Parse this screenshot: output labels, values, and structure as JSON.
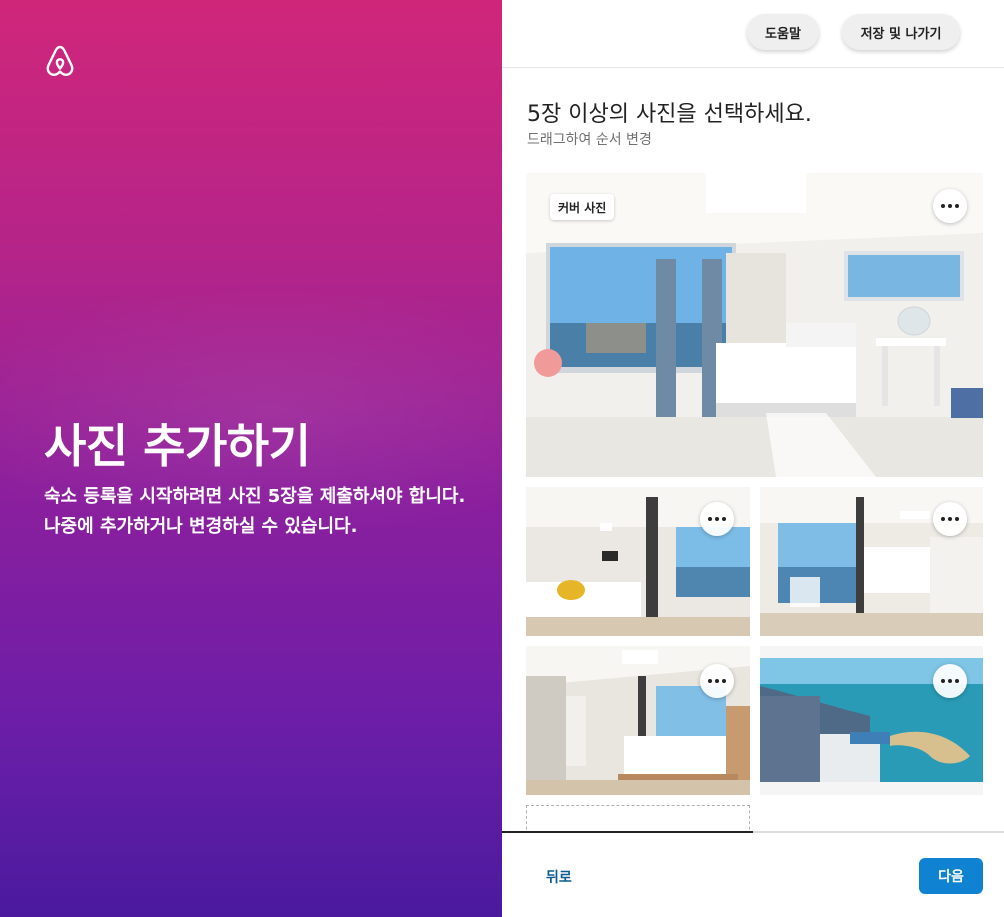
{
  "header": {
    "help_label": "도움말",
    "save_exit_label": "저장 및 나가기"
  },
  "hero": {
    "title": "사진 추가하기",
    "description": "숙소 등록을 시작하려면 사진 5장을 제출하셔야 합니다. 나중에 추가하거나 변경하실 수 있습니다."
  },
  "main": {
    "heading": "5장 이상의 사진을 선택하세요.",
    "subheading": "드래그하여 순서 변경",
    "cover_badge": "커버 사진",
    "photos": [
      {
        "id": "cover",
        "subject": "bedroom-ocean-view"
      },
      {
        "id": "photo-2",
        "subject": "bedroom-yellow-pillow"
      },
      {
        "id": "photo-3",
        "subject": "bedroom-balcony"
      },
      {
        "id": "photo-4",
        "subject": "bedroom-kitchen"
      },
      {
        "id": "photo-5",
        "subject": "aerial-beach"
      }
    ]
  },
  "footer": {
    "back_label": "뒤로",
    "next_label": "다음",
    "progress": 0.5
  },
  "colors": {
    "brand_gradient_top": "#d0267a",
    "brand_gradient_bottom": "#4a1a9e",
    "next_button": "#0f83d1",
    "back_link": "#0b5c8f"
  },
  "icons": [
    "airbnb-logo-icon",
    "more-options-icon"
  ]
}
